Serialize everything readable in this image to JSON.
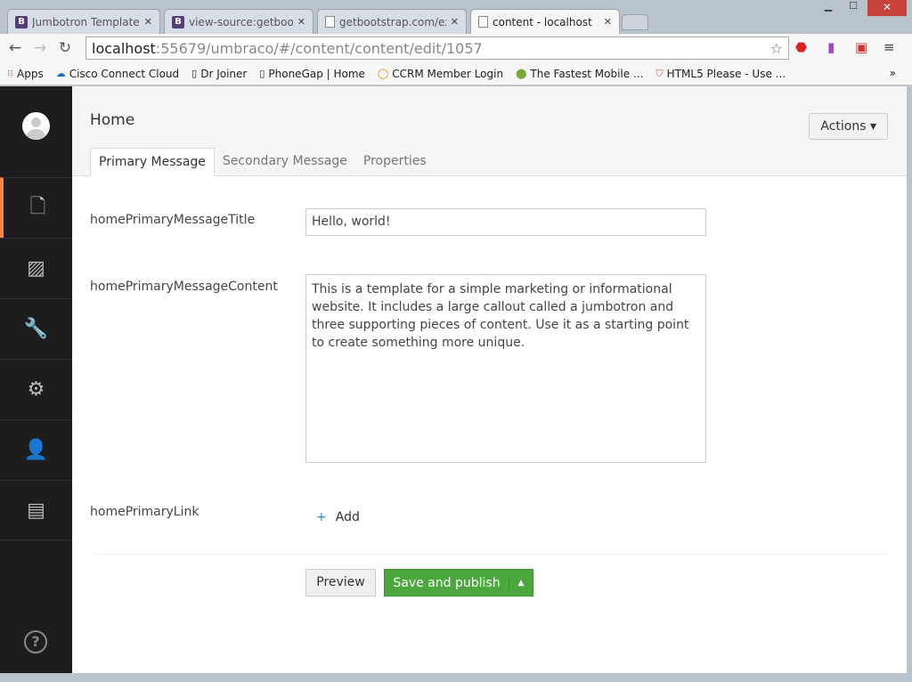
{
  "browser": {
    "tabs": [
      {
        "label": "Jumbotron Template",
        "icon": "bootstrap-icon"
      },
      {
        "label": "view-source:getboots",
        "icon": "bootstrap-icon"
      },
      {
        "label": "getbootstrap.com/exa",
        "icon": "page-icon"
      },
      {
        "label": "content - localhost",
        "icon": "page-icon"
      }
    ],
    "url_host": "localhost",
    "url_rest": ":55679/umbraco/#/content/content/edit/1057",
    "bookmarks": [
      "Apps",
      "Cisco Connect Cloud",
      "Dr Joiner",
      "PhoneGap | Home",
      "CCRM Member Login",
      "The Fastest Mobile ...",
      "HTML5 Please - Use ..."
    ],
    "more": "»"
  },
  "page": {
    "title": "Home",
    "actions": "Actions ▾",
    "tabs": [
      "Primary Message",
      "Secondary Message",
      "Properties"
    ],
    "fields": {
      "title_label": "homePrimaryMessageTitle",
      "title_value": "Hello, world!",
      "content_label": "homePrimaryMessageContent",
      "content_value": "This is a template for a simple marketing or informational website. It includes a large callout called a jumbotron and three supporting pieces of content. Use it as a starting point to create something more unique.",
      "link_label": "homePrimaryLink",
      "add": "Add"
    },
    "preview": "Preview",
    "save": "Save and publish"
  },
  "colors": {
    "accent": "#f5853d",
    "save": "#4aa83c",
    "sidebar": "#1d1d1d"
  }
}
